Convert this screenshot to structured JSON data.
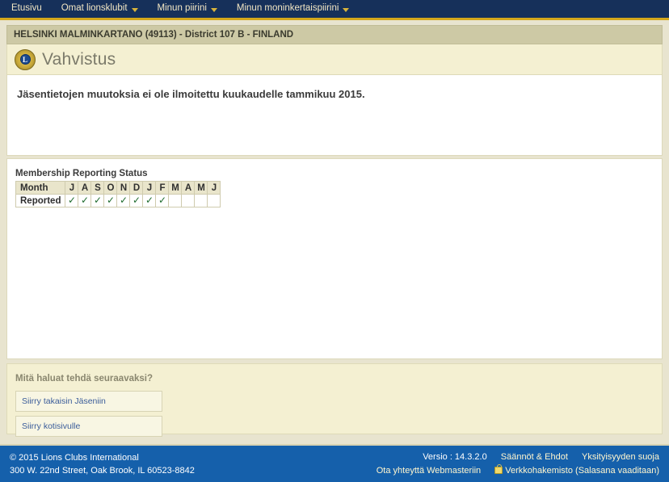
{
  "nav": {
    "items": [
      {
        "label": "Etusivu",
        "has_caret": false
      },
      {
        "label": "Omat lionsklubit",
        "has_caret": true
      },
      {
        "label": "Minun piirini",
        "has_caret": true
      },
      {
        "label": "Minun moninkertaispiirini",
        "has_caret": true
      }
    ]
  },
  "club_bar": {
    "text": "HELSINKI MALMINKARTANO (49113) - District 107 B - FINLAND"
  },
  "header": {
    "logo_letter": "L",
    "title": "Vahvistus"
  },
  "message": {
    "text": "Jäsentietojen muutoksia ei ole ilmoitettu kuukaudelle tammikuu 2015."
  },
  "reporting_table": {
    "caption": "Membership Reporting Status",
    "row_labels": [
      "Month",
      "Reported"
    ],
    "months": [
      "J",
      "A",
      "S",
      "O",
      "N",
      "D",
      "J",
      "F",
      "M",
      "A",
      "M",
      "J"
    ],
    "reported": [
      true,
      true,
      true,
      true,
      true,
      true,
      true,
      true,
      false,
      false,
      false,
      false
    ],
    "tick_glyph": "✓"
  },
  "next_section": {
    "title": "Mitä haluat tehdä seuraavaksi?",
    "buttons": [
      {
        "label": "Siirry takaisin Jäseniin"
      },
      {
        "label": "Siirry kotisivulle"
      }
    ]
  },
  "footer": {
    "copyright": "© 2015 Lions Clubs International",
    "address": "300 W. 22nd Street, Oak Brook, IL 60523-8842",
    "version": "Versio : 14.3.2.0",
    "terms": "Säännöt & Ehdot",
    "privacy": "Yksityisyyden suoja",
    "webmaster": "Ota yhteyttä Webmasteriin",
    "directory": "Verkkohakemisto (Salasana vaaditaan)"
  },
  "colors": {
    "nav_bg": "#16305a",
    "nav_accent": "#d4a71c",
    "footer_bg": "#1560ab",
    "panel_cream": "#f4f0d2",
    "club_bar": "#cdc9a5",
    "tick_green": "#1f6b2f",
    "link_blue": "#3a5c9a"
  }
}
